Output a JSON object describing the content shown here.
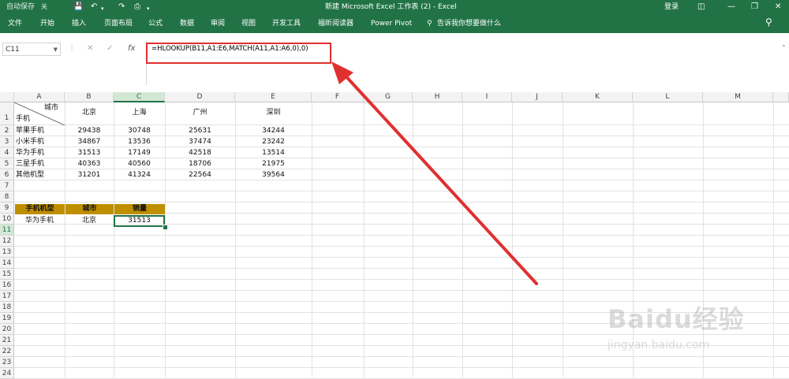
{
  "titlebar": {
    "autosave": "自动保存",
    "autosave_state": "关",
    "title": "新建 Microsoft Excel 工作表 (2)  -  Excel",
    "login": "登录"
  },
  "tabs": [
    "文件",
    "开始",
    "插入",
    "页面布局",
    "公式",
    "数据",
    "审阅",
    "视图",
    "开发工具",
    "福昕阅读器",
    "Power Pivot",
    "告诉我你想要做什么"
  ],
  "formula_bar": {
    "name_box": "C11",
    "fx_label": "fx",
    "formula": "=HLOOKUP(B11,A1:E6,MATCH(A11,A1:A6,0),0)"
  },
  "columns": [
    "A",
    "B",
    "C",
    "D",
    "E",
    "F",
    "G",
    "H",
    "I",
    "J",
    "K",
    "L",
    "M"
  ],
  "rows": [
    "1",
    "2",
    "3",
    "4",
    "5",
    "6",
    "7",
    "8",
    "9",
    "10",
    "11",
    "12",
    "13",
    "14",
    "15",
    "16",
    "17",
    "18",
    "19",
    "20",
    "21",
    "22",
    "23",
    "24"
  ],
  "table": {
    "corner_top": "城市",
    "corner_bottom": "手机",
    "cities": [
      "北京",
      "上海",
      "广州",
      "深圳"
    ],
    "data_rows": [
      {
        "name": "苹果手机",
        "values": [
          "29438",
          "30748",
          "25631",
          "34244"
        ]
      },
      {
        "name": "小米手机",
        "values": [
          "34867",
          "13536",
          "37474",
          "23242"
        ]
      },
      {
        "name": "华为手机",
        "values": [
          "31513",
          "17149",
          "42518",
          "13514"
        ]
      },
      {
        "name": "三星手机",
        "values": [
          "40363",
          "40560",
          "18706",
          "21975"
        ]
      },
      {
        "name": "其他机型",
        "values": [
          "31201",
          "41324",
          "22564",
          "39564"
        ]
      }
    ]
  },
  "lookup": {
    "headers": [
      "手机机型",
      "城市",
      "销量"
    ],
    "row": [
      "华为手机",
      "北京",
      "31513"
    ]
  },
  "colors": {
    "excel_green": "#217346",
    "header_gold": "#bf8f00",
    "annotation_red": "#e03030"
  },
  "watermark": {
    "logo": "Baidu经验",
    "url": "jingyan.baidu.com"
  }
}
